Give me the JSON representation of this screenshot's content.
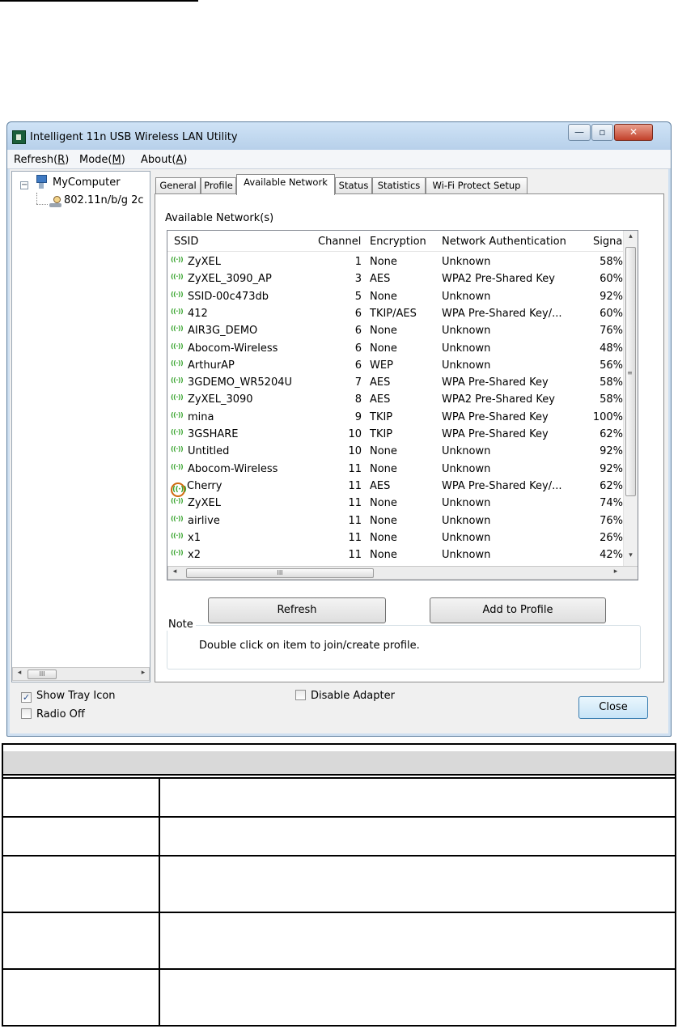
{
  "window": {
    "title": "Intelligent 11n USB Wireless LAN Utility",
    "min_glyph": "—",
    "max_glyph": "▫",
    "close_glyph": "✕"
  },
  "menu": {
    "refresh_pre": "Refresh(",
    "refresh_key": "R",
    "refresh_post": ")",
    "mode_pre": "Mode(",
    "mode_key": "M",
    "mode_post": ")",
    "about_pre": "About(",
    "about_key": "A",
    "about_post": ")"
  },
  "tree": {
    "root": "MyComputer",
    "child": "802.11n/b/g 2c",
    "expander": "−",
    "scroll_thumb": "III"
  },
  "tabs": [
    "General",
    "Profile",
    "Available Network",
    "Status",
    "Statistics",
    "Wi-Fi Protect Setup"
  ],
  "available": {
    "section_label": "Available Network(s)",
    "columns": [
      "SSID",
      "Channel",
      "Encryption",
      "Network Authentication",
      "Signa"
    ],
    "icon_glyph": "((·))",
    "rows": [
      {
        "ssid": "ZyXEL",
        "ch": "1",
        "enc": "None",
        "auth": "Unknown",
        "sig": "58%"
      },
      {
        "ssid": "ZyXEL_3090_AP",
        "ch": "3",
        "enc": "AES",
        "auth": "WPA2 Pre-Shared Key",
        "sig": "60%"
      },
      {
        "ssid": "SSID-00c473db",
        "ch": "5",
        "enc": "None",
        "auth": "Unknown",
        "sig": "92%"
      },
      {
        "ssid": "412",
        "ch": "6",
        "enc": "TKIP/AES",
        "auth": "WPA Pre-Shared Key/...",
        "sig": "60%"
      },
      {
        "ssid": "AIR3G_DEMO",
        "ch": "6",
        "enc": "None",
        "auth": "Unknown",
        "sig": "76%"
      },
      {
        "ssid": "Abocom-Wireless",
        "ch": "6",
        "enc": "None",
        "auth": "Unknown",
        "sig": "48%"
      },
      {
        "ssid": "ArthurAP",
        "ch": "6",
        "enc": "WEP",
        "auth": "Unknown",
        "sig": "56%"
      },
      {
        "ssid": "3GDEMO_WR5204U",
        "ch": "7",
        "enc": "AES",
        "auth": "WPA Pre-Shared Key",
        "sig": "58%"
      },
      {
        "ssid": "ZyXEL_3090",
        "ch": "8",
        "enc": "AES",
        "auth": "WPA2 Pre-Shared Key",
        "sig": "58%"
      },
      {
        "ssid": "mina",
        "ch": "9",
        "enc": "TKIP",
        "auth": "WPA Pre-Shared Key",
        "sig": "100%"
      },
      {
        "ssid": "3GSHARE",
        "ch": "10",
        "enc": "TKIP",
        "auth": "WPA Pre-Shared Key",
        "sig": "62%"
      },
      {
        "ssid": "Untitled",
        "ch": "10",
        "enc": "None",
        "auth": "Unknown",
        "sig": "92%"
      },
      {
        "ssid": "Abocom-Wireless",
        "ch": "11",
        "enc": "None",
        "auth": "Unknown",
        "sig": "92%"
      },
      {
        "ssid": "Cherry",
        "ch": "11",
        "enc": "AES",
        "auth": "WPA Pre-Shared Key/...",
        "sig": "62%",
        "connected": true
      },
      {
        "ssid": "ZyXEL",
        "ch": "11",
        "enc": "None",
        "auth": "Unknown",
        "sig": "74%"
      },
      {
        "ssid": "airlive",
        "ch": "11",
        "enc": "None",
        "auth": "Unknown",
        "sig": "76%"
      },
      {
        "ssid": "x1",
        "ch": "11",
        "enc": "None",
        "auth": "Unknown",
        "sig": "26%"
      },
      {
        "ssid": "x2",
        "ch": "11",
        "enc": "None",
        "auth": "Unknown",
        "sig": "42%"
      }
    ],
    "scroll_thumb": "III",
    "vthumb_grip": "≡",
    "refresh_button": "Refresh",
    "add_profile_button": "Add to Profile",
    "note_title": "Note",
    "note_text": "Double click on item to join/create profile."
  },
  "footer": {
    "show_tray_icon": "Show Tray Icon",
    "show_tray_checked": true,
    "radio_off": "Radio Off",
    "radio_off_checked": false,
    "disable_adapter": "Disable Adapter",
    "disable_adapter_checked": false,
    "close_button": "Close"
  },
  "arrows": {
    "left": "◂",
    "right": "▸",
    "up": "▴",
    "down": "▾"
  },
  "colors": {
    "signal_icon": "#3aa530",
    "connected_ring": "#d06a10",
    "header_shade": "#d9d9d9"
  }
}
